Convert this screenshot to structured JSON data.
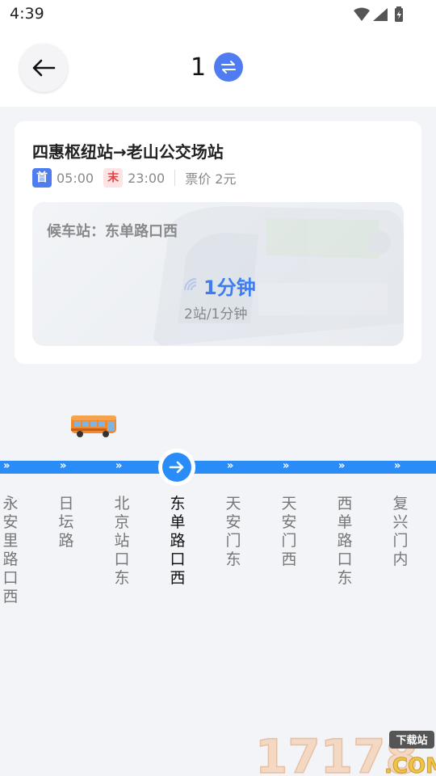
{
  "status_bar": {
    "time": "4:39"
  },
  "header": {
    "route_number": "1"
  },
  "card": {
    "route": "四惠枢纽站→老山公交场站",
    "first_tag": "首",
    "first_time": "05:00",
    "last_tag": "末",
    "last_time": "23:00",
    "fare": "票价 2元",
    "wait_station": "候车站：东单路口西",
    "eta": "1分钟",
    "eta_detail": "2站/1分钟"
  },
  "stops": [
    "永安里路口西",
    "日坛路",
    "北京站口东",
    "东单路口西",
    "天安门东",
    "天安门西",
    "西单路口东",
    "复兴门内"
  ],
  "current_stop_index": 3,
  "watermark": {
    "text": "17178",
    "sub": ".COM",
    "badge": "下载站"
  },
  "colors": {
    "accent": "#2a8df7",
    "swap": "#4f7cf0",
    "eta": "#3d7df0"
  },
  "icons": [
    "back-arrow-icon",
    "swap-icon",
    "wifi-icon",
    "signal-icon",
    "battery-icon",
    "bus-icon",
    "arrow-right-icon"
  ]
}
